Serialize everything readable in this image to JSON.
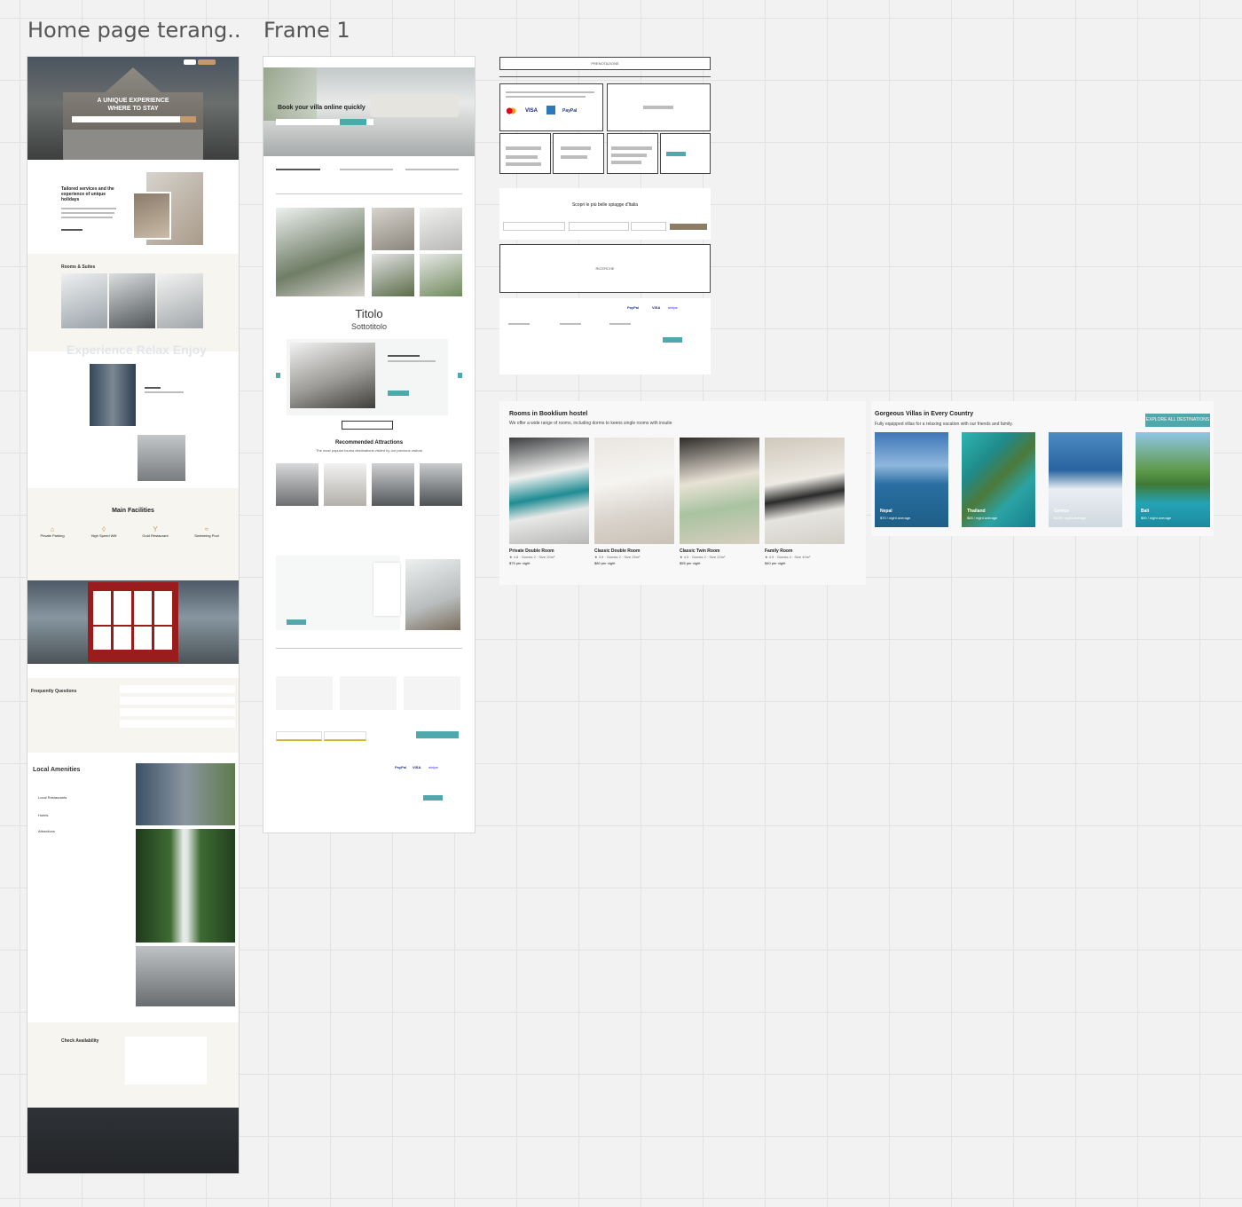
{
  "canvas_colors": {
    "bg": "#f1f2f1",
    "teal": "#4ea8ac",
    "dark": "#2a2d30",
    "red": "#9b1c1c"
  },
  "frames": {
    "home": {
      "title": "Home page terang..."
    },
    "frame1": {
      "title": "Frame 1"
    }
  },
  "home": {
    "hero": {
      "title_line1": "A UNIQUE EXPERIENCE",
      "title_line2": "WHERE TO STAY"
    },
    "tailored": {
      "heading": "Tailored services and the experience of unique holidays"
    },
    "rooms": {
      "heading": "Rooms & Suites"
    },
    "experience": {
      "ghost_text": "Experience Relax Enjoy"
    },
    "facilities": {
      "heading": "Main Facilities",
      "items": [
        {
          "label": "Private Parking",
          "icon": "parking-icon"
        },
        {
          "label": "High Speed Wifi",
          "icon": "wifi-icon"
        },
        {
          "label": "Gold Restaurant",
          "icon": "restaurant-icon"
        },
        {
          "label": "Swimming Pool",
          "icon": "pool-icon"
        }
      ]
    },
    "faq": {
      "heading": "Frequently Questions"
    },
    "amenities": {
      "heading": "Local Amenities",
      "items": [
        "Local Restaurants",
        "Hotels",
        "Attractions"
      ]
    },
    "availability": {
      "heading": "Check Availability"
    }
  },
  "frame1": {
    "hero": {
      "title": "Book your villa online quickly"
    },
    "titolo": "Titolo",
    "sottotitolo": "Sottotitolo",
    "attractions": {
      "heading": "Recommended Attractions",
      "subheading": "The most popular tourist destinations visited by our previous visitors"
    },
    "footer": {
      "payments": [
        "PayPal",
        "VISA",
        "stripe"
      ]
    }
  },
  "wireframes": {
    "top_label": "PRENOTAZIONE",
    "payments": [
      "VISA",
      "PayPal"
    ],
    "search_heading": "Scopri le più belle spiagge d'Italia",
    "box_label": "RICERCHE",
    "footer_payments": [
      "PayPal",
      "VISA",
      "stripe"
    ]
  },
  "rooms_card": {
    "title": "Rooms in Booklium hostel",
    "subtitle": "We offer a wide range of rooms, including dorms to keens single rooms with insuite",
    "rooms": [
      {
        "name": "Private Double Room",
        "meta": "★ 4.8 · Guests 2 · Size 20m²",
        "price": "$75 per night"
      },
      {
        "name": "Classic Double Room",
        "meta": "★ 3.9 · Guests 2 · Size 25m²",
        "price": "$80 per night"
      },
      {
        "name": "Classic Twin Room",
        "meta": "★ 4.5 · Guests 2 · Size 22m²",
        "price": "$55 per night"
      },
      {
        "name": "Family Room",
        "meta": "★ 4.9 · Guests 4 · Size 40m²",
        "price": "$40 per night"
      }
    ]
  },
  "villas_card": {
    "title": "Gorgeous Villas in Every Country",
    "subtitle": "Fully equipped villas for a relaxing vacation with our friends and family.",
    "button_label": "EXPLORE ALL DESTINATIONS",
    "destinations": [
      {
        "name": "Nepal",
        "price": "$70 / night average"
      },
      {
        "name": "Thailand",
        "price": "$65 / night average"
      },
      {
        "name": "Greece",
        "price": "$150 / night average"
      },
      {
        "name": "Bali",
        "price": "$90 / night average"
      }
    ]
  }
}
